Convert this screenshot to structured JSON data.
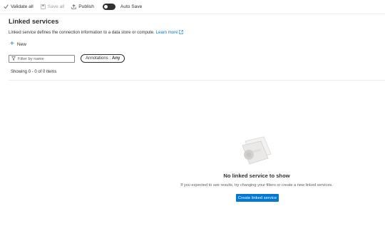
{
  "toolbar": {
    "validate_label": "Validate all",
    "save_label": "Save all",
    "publish_label": "Publish",
    "autosave_label": "Auto Save"
  },
  "page": {
    "title": "Linked services",
    "description": "Linked service defines the connection information to a data store or compute.",
    "learn_more": "Learn more"
  },
  "actions": {
    "new_label": "New"
  },
  "filter": {
    "placeholder": "Filter by name",
    "annotations_label": "Annotations :",
    "annotations_value": "Any"
  },
  "list": {
    "showing": "Showing 0 - 0 of 0 items"
  },
  "empty_state": {
    "title": "No linked service to show",
    "subtitle": "If you expected to see results, try changing your filters or create a new linked services.",
    "button_label": "Create linked service"
  },
  "colors": {
    "accent": "#0078d4",
    "text": "#323130",
    "muted": "#605e5c"
  }
}
